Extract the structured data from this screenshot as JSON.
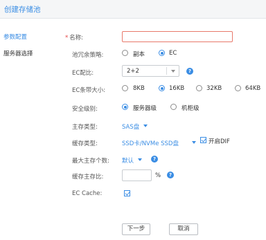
{
  "window": {
    "title": "创建存储池"
  },
  "sidebar": {
    "items": [
      {
        "label": "参数配置",
        "active": true
      },
      {
        "label": "服务器选择",
        "active": false
      }
    ]
  },
  "form": {
    "name": {
      "required_mark": "*",
      "label": "名称:",
      "value": ""
    },
    "redundancy_policy": {
      "label": "池冗余策略:",
      "options": [
        "副本",
        "EC"
      ],
      "selected": "EC"
    },
    "ec_config": {
      "label": "EC配比:",
      "value": "2+2"
    },
    "ec_strip_size": {
      "label": "EC条带大小:",
      "options": [
        "8KB",
        "16KB",
        "32KB",
        "64KB"
      ],
      "selected": "16KB"
    },
    "security_level": {
      "label": "安全级别:",
      "options": [
        "服务器级",
        "机柜级"
      ],
      "selected": "服务器级"
    },
    "main_storage_type": {
      "label": "主存类型:",
      "value": "SAS盘"
    },
    "cache_type": {
      "label": "缓存类型:",
      "value": "SSD卡/NVMe SSD盘",
      "dif_label": "开启DIF",
      "dif_checked": true
    },
    "max_main_storage": {
      "label": "最大主存个数:",
      "value": "默认"
    },
    "cache_ratio": {
      "label": "缓存主存比:",
      "value": "",
      "unit": "%"
    },
    "ec_cache": {
      "label": "EC Cache:",
      "checked": true
    }
  },
  "buttons": {
    "next": "下一步",
    "cancel": "取消"
  },
  "colors": {
    "accent": "#3a8de4",
    "required": "#e64545",
    "error_border": "#e8796b"
  },
  "icons": {
    "help": "question-circle-icon",
    "dropdown": "caret-down-icon"
  }
}
